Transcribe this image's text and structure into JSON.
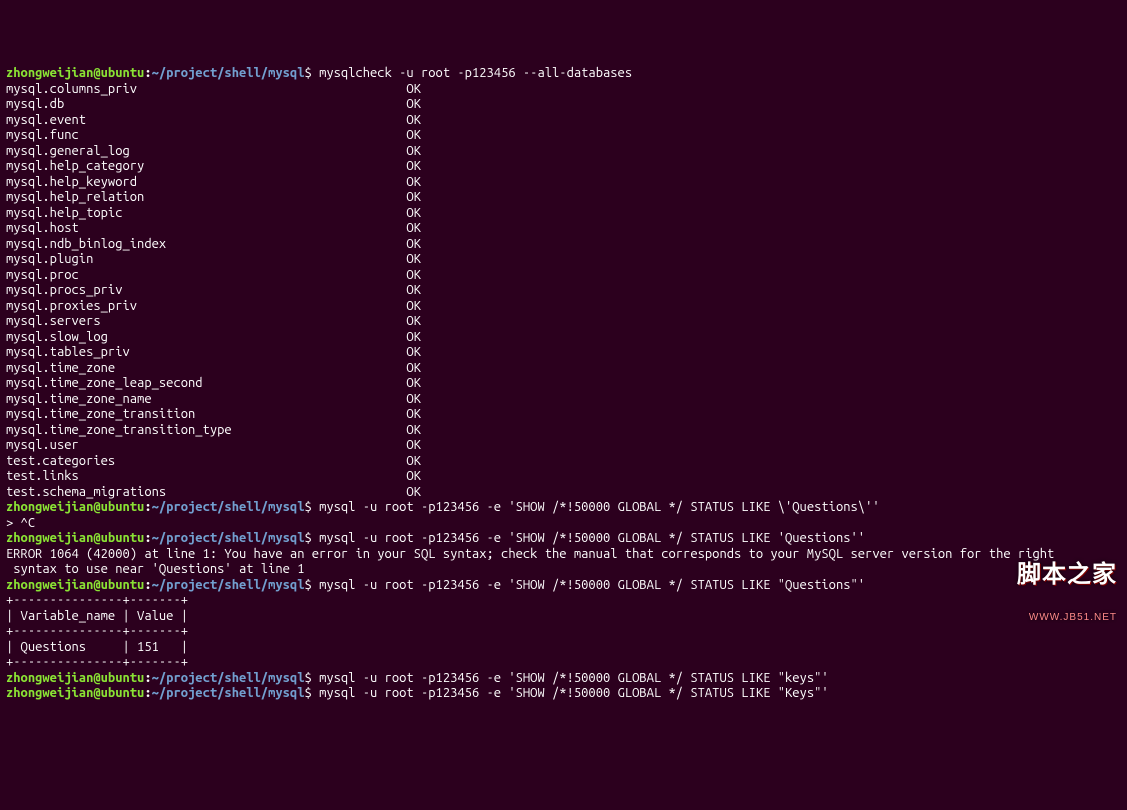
{
  "prompt": {
    "user": "zhongweijian@ubuntu",
    "sep": ":",
    "path": "~/project/shell/mysql",
    "end": "$"
  },
  "cmds": {
    "c0": "mysqlcheck -u root -p123456 --all-databases",
    "c1": "mysql -u root -p123456 -e 'SHOW /*!50000 GLOBAL */ STATUS LIKE \\'Questions\\''",
    "c2": "mysql -u root -p123456 -e 'SHOW /*!50000 GLOBAL */ STATUS LIKE 'Questions''",
    "c3": "mysql -u root -p123456 -e 'SHOW /*!50000 GLOBAL */ STATUS LIKE \"Questions\"'",
    "c4": "mysql -u root -p123456 -e 'SHOW /*!50000 GLOBAL */ STATUS LIKE \"keys\"'",
    "c5": "mysql -u root -p123456 -e 'SHOW /*!50000 GLOBAL */ STATUS LIKE \"Keys\"'"
  },
  "check": [
    {
      "name": "mysql.columns_priv",
      "status": "OK"
    },
    {
      "name": "mysql.db",
      "status": "OK"
    },
    {
      "name": "mysql.event",
      "status": "OK"
    },
    {
      "name": "mysql.func",
      "status": "OK"
    },
    {
      "name": "mysql.general_log",
      "status": "OK"
    },
    {
      "name": "mysql.help_category",
      "status": "OK"
    },
    {
      "name": "mysql.help_keyword",
      "status": "OK"
    },
    {
      "name": "mysql.help_relation",
      "status": "OK"
    },
    {
      "name": "mysql.help_topic",
      "status": "OK"
    },
    {
      "name": "mysql.host",
      "status": "OK"
    },
    {
      "name": "mysql.ndb_binlog_index",
      "status": "OK"
    },
    {
      "name": "mysql.plugin",
      "status": "OK"
    },
    {
      "name": "mysql.proc",
      "status": "OK"
    },
    {
      "name": "mysql.procs_priv",
      "status": "OK"
    },
    {
      "name": "mysql.proxies_priv",
      "status": "OK"
    },
    {
      "name": "mysql.servers",
      "status": "OK"
    },
    {
      "name": "mysql.slow_log",
      "status": "OK"
    },
    {
      "name": "mysql.tables_priv",
      "status": "OK"
    },
    {
      "name": "mysql.time_zone",
      "status": "OK"
    },
    {
      "name": "mysql.time_zone_leap_second",
      "status": "OK"
    },
    {
      "name": "mysql.time_zone_name",
      "status": "OK"
    },
    {
      "name": "mysql.time_zone_transition",
      "status": "OK"
    },
    {
      "name": "mysql.time_zone_transition_type",
      "status": "OK"
    },
    {
      "name": "mysql.user",
      "status": "OK"
    },
    {
      "name": "test.categories",
      "status": "OK"
    },
    {
      "name": "test.links",
      "status": "OK"
    },
    {
      "name": "test.schema_migrations",
      "status": "OK"
    }
  ],
  "break": "> ^C",
  "error": "ERROR 1064 (42000) at line 1: You have an error in your SQL syntax; check the manual that corresponds to your MySQL server version for the right\n syntax to use near 'Questions' at line 1",
  "table": {
    "border": "+---------------+-------+",
    "header": "| Variable_name | Value |",
    "row": "| Questions     | 151   |"
  },
  "watermark": {
    "top": "脚本之家",
    "bot": "WWW.JB51.NET"
  }
}
